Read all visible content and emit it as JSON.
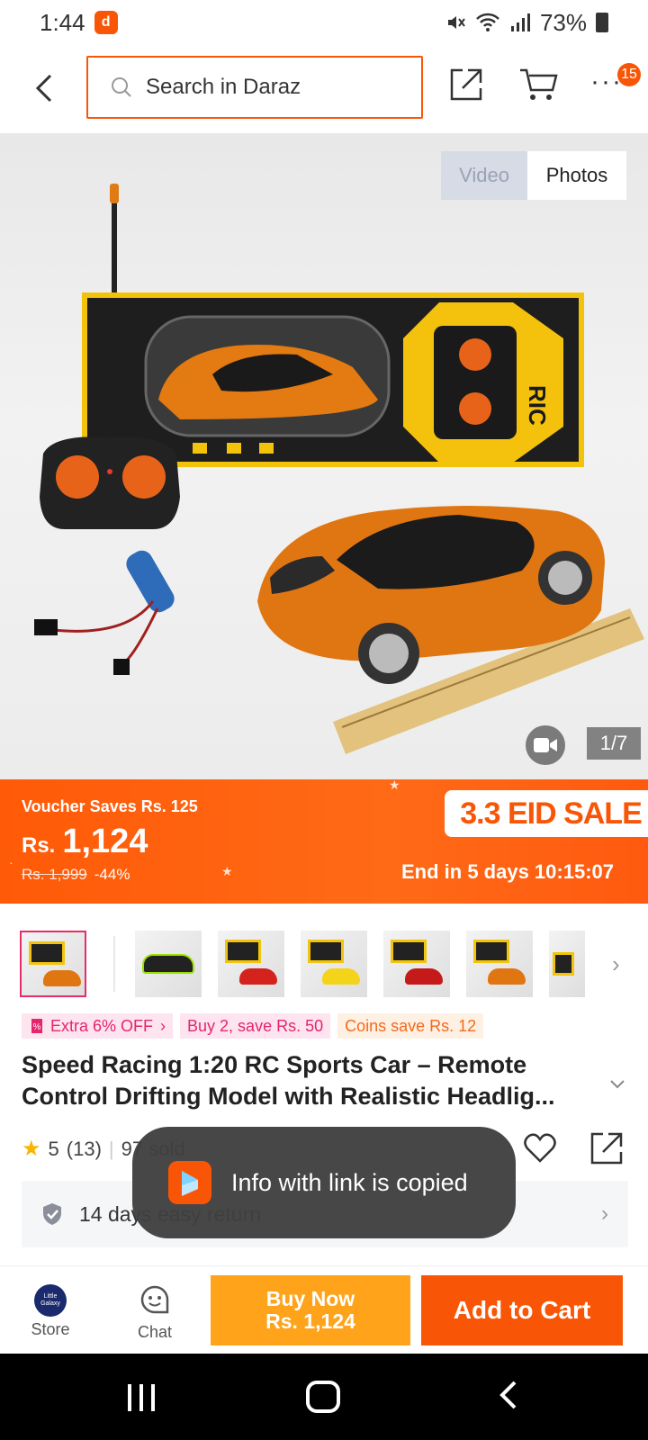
{
  "status": {
    "time": "1:44",
    "battery": "73%",
    "colors": {
      "brand": "#f85606"
    }
  },
  "header": {
    "search_placeholder": "Search in Daraz",
    "more_badge": "15"
  },
  "gallery": {
    "tab_video": "Video",
    "tab_photos": "Photos",
    "counter": "1/7"
  },
  "promo": {
    "voucher": "Voucher Saves Rs. 125",
    "currency": "Rs.",
    "price": "1,124",
    "old_price": "Rs. 1,999",
    "discount": "-44%",
    "sale_badge": "3.3 EID SALE",
    "countdown": "End in 5 days 10:15:07"
  },
  "tags": [
    {
      "label": "Extra 6% OFF",
      "icon": "coupon-icon"
    },
    {
      "label": "Buy 2, save Rs. 50"
    },
    {
      "label": "Coins save Rs. 12"
    }
  ],
  "product": {
    "title": "Speed Racing 1:20 RC Sports Car – Remote Control Drifting Model with Realistic Headlig...",
    "rating": "5",
    "reviews": "(13)",
    "sold": "97 sold"
  },
  "return_policy": "14 days easy return",
  "toast": "Info with link is copied",
  "actions": {
    "store": "Store",
    "store_logo": "Little Galaxy",
    "chat": "Chat",
    "buy_now": "Buy Now",
    "buy_now_price": "Rs. 1,124",
    "add_to_cart": "Add to Cart"
  }
}
